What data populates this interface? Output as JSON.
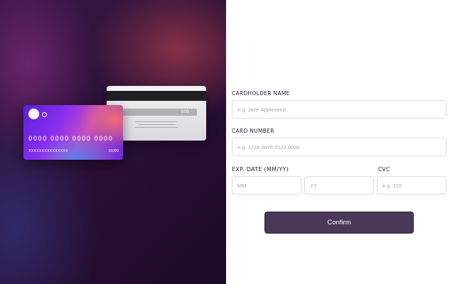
{
  "card_front": {
    "number": "0000 0000 0000 0000",
    "holder": "XXXXXXXXXXXXXXX",
    "expiry": "00/00"
  },
  "card_back": {
    "cvc": "000"
  },
  "form": {
    "cardholder_label": "CARDHOLDER NAME",
    "cardholder_placeholder": "e.g. Jane Appleseed",
    "number_label": "CARD NUMBER",
    "number_placeholder": "e.g. 1234 5678 9123 0000",
    "expiry_label": "EXP. DATE (MM/YY)",
    "month_placeholder": "MM",
    "year_placeholder": "YY",
    "cvc_label": "CVC",
    "cvc_placeholder": "e.g. 123",
    "confirm_label": "Confirm"
  },
  "colors": {
    "button_bg": "#4b3858",
    "panel_dark": "#2a0f36"
  }
}
